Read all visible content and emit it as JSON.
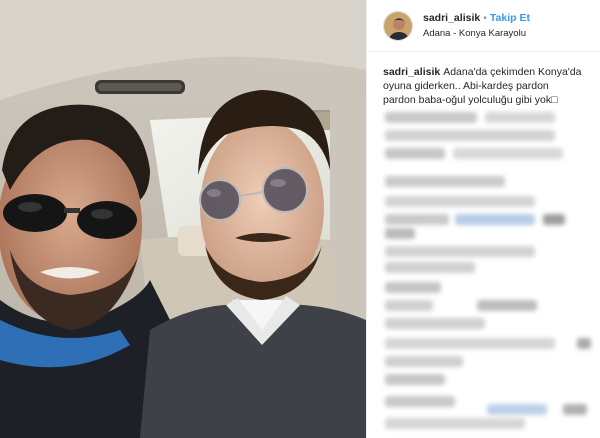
{
  "header": {
    "username": "sadri_alisik",
    "separator": "•",
    "follow_label": "Takip Et",
    "location": "Adana - Konya Karayolu"
  },
  "caption": {
    "username": "sadri_alisik",
    "text": "Adana'da çekimden Konya'da oyuna giderken.. Abi-kardeş pardon pardon baba-oğul yolculuğu gibi yok□"
  },
  "colors": {
    "link_blue": "#3897f0",
    "text_dark": "#262626",
    "border": "#efefef"
  },
  "icons": {
    "photo": "selfie-photo",
    "avatar": "profile-avatar"
  }
}
